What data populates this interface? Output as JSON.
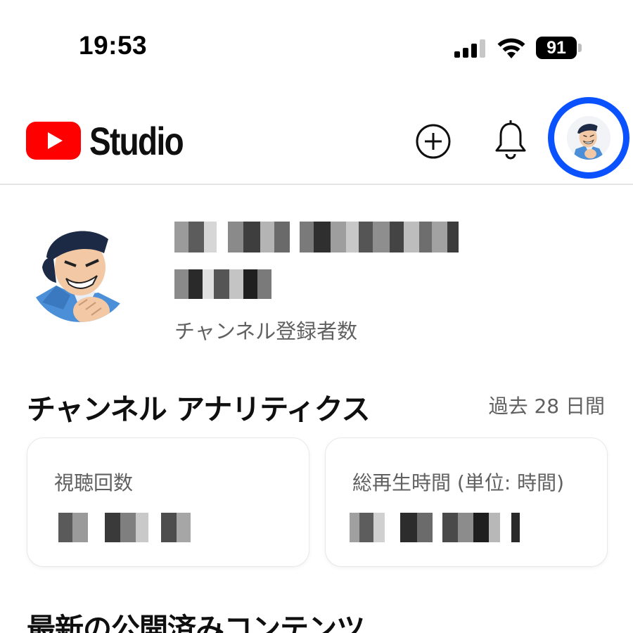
{
  "status_bar": {
    "time": "19:53",
    "battery_level": "91",
    "signal_bars_filled": 3,
    "signal_bars_total": 4,
    "icons": [
      "cellular-signal-icon",
      "wifi-icon",
      "battery-icon"
    ]
  },
  "app_bar": {
    "logo_text": "Studio",
    "logo_icon": "youtube-play-icon",
    "brand_color": "#ff0000",
    "create_icon": "plus-circle-icon",
    "notifications_icon": "bell-icon",
    "account_icon": "account-avatar",
    "account_highlight_color": "#0a52ff"
  },
  "channel": {
    "name": "",
    "name_obscured": true,
    "subscriber_count": "",
    "subscriber_count_obscured": true,
    "subscriber_label": "チャンネル登録者数"
  },
  "analytics": {
    "title": "チャンネル アナリティクス",
    "period": "過去 28 日間",
    "cards": [
      {
        "label": "視聴回数",
        "value": "",
        "value_obscured": true
      },
      {
        "label": "総再生時間 (単位: 時間)",
        "value": "",
        "value_obscured": true
      }
    ]
  },
  "latest_content": {
    "title": "最新の公開済みコンテンツ"
  }
}
